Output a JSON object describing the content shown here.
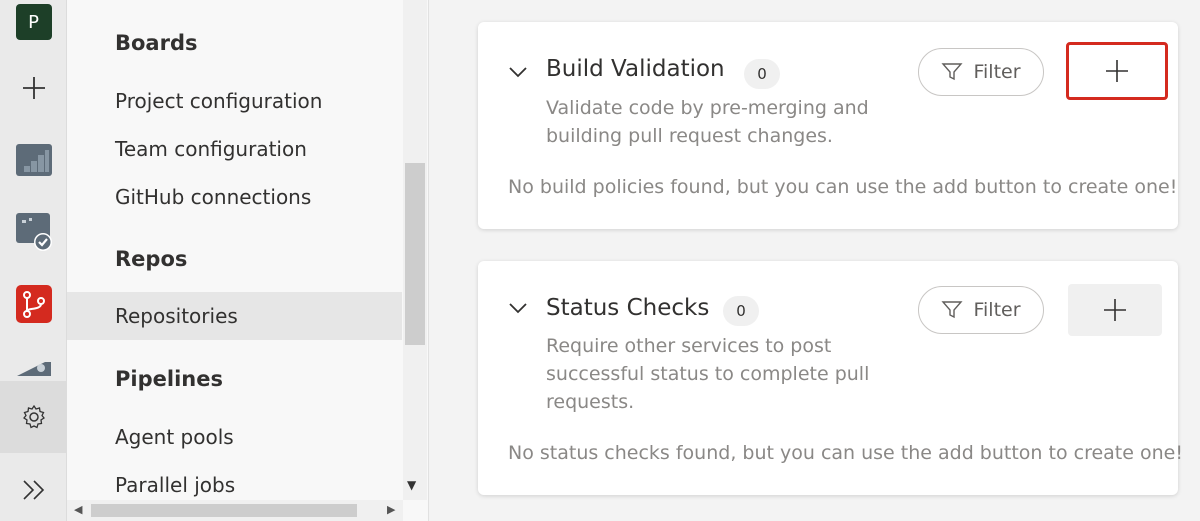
{
  "rail": {
    "avatar_letter": "P",
    "items": [
      "add-icon",
      "boards-icon",
      "test-plans-icon",
      "repos-icon",
      "pipelines-icon",
      "settings-icon",
      "expand-icon"
    ],
    "repos_color": "#d42a1f",
    "avatar_color": "#1d3f28"
  },
  "sidebar": {
    "boards": {
      "title": "Boards",
      "items": [
        "Project configuration",
        "Team configuration",
        "GitHub connections"
      ]
    },
    "repos": {
      "title": "Repos",
      "items": [
        "Repositories"
      ]
    },
    "pipelines": {
      "title": "Pipelines",
      "items": [
        "Agent pools",
        "Parallel jobs"
      ]
    }
  },
  "build_validation": {
    "title": "Build Validation",
    "count": "0",
    "description": "Validate code by pre-merging and building pull request changes.",
    "filter_label": "Filter",
    "empty_message": "No build policies found, but you can use the add button to create one!"
  },
  "status_checks": {
    "title": "Status Checks",
    "count": "0",
    "description": "Require other services to post successful status to complete pull requests.",
    "filter_label": "Filter",
    "empty_message": "No status checks found, but you can use the add button to create one!"
  },
  "colors": {
    "highlight_border": "#d42a1f",
    "accent_blue": "#0078d4"
  }
}
